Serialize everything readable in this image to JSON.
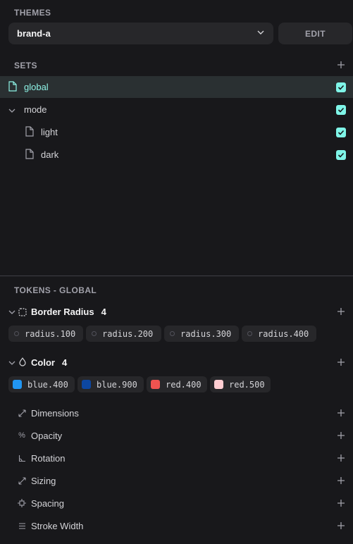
{
  "themes": {
    "label": "THEMES",
    "selected": "brand-a",
    "edit_label": "EDIT"
  },
  "sets": {
    "label": "SETS",
    "items": [
      {
        "label": "global",
        "active": true
      },
      {
        "label": "mode"
      },
      {
        "label": "light"
      },
      {
        "label": "dark"
      }
    ]
  },
  "tokens": {
    "label": "TOKENS - GLOBAL",
    "groups": [
      {
        "name": "Border Radius",
        "count": "4",
        "tokens": [
          "radius.100",
          "radius.200",
          "radius.300",
          "radius.400"
        ]
      },
      {
        "name": "Color",
        "count": "4",
        "tokens": [
          {
            "label": "blue.400",
            "color": "#2196f3"
          },
          {
            "label": "blue.900",
            "color": "#0d47a1"
          },
          {
            "label": "red.400",
            "color": "#ef5350"
          },
          {
            "label": "red.500",
            "color": "#ffcdd2"
          }
        ]
      }
    ],
    "categories": [
      "Dimensions",
      "Opacity",
      "Rotation",
      "Sizing",
      "Spacing",
      "Stroke Width"
    ]
  },
  "colors": {
    "accent": "#7ff5e8",
    "active_text": "#8ef3e6",
    "active_row": "#2a3032"
  }
}
